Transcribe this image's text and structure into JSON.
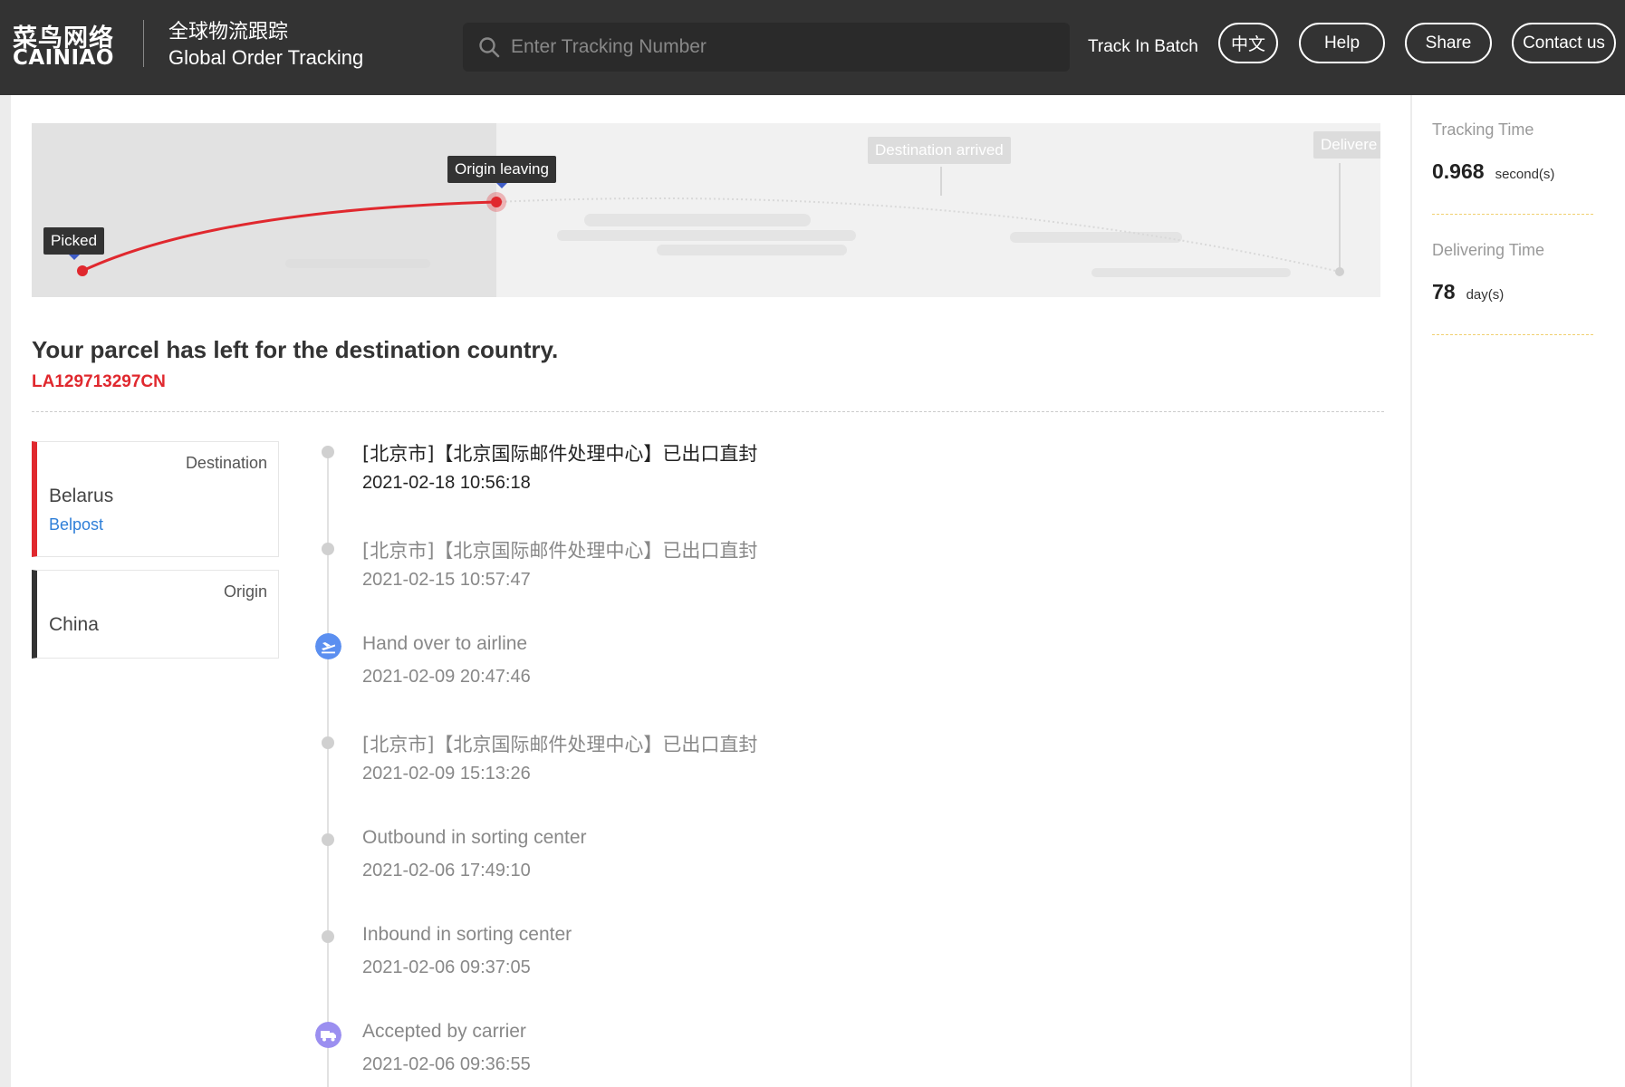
{
  "header": {
    "logo_cn": "菜鸟网络",
    "logo_en": "CAINIAO",
    "brand_cn": "全球物流跟踪",
    "brand_en": "Global Order Tracking",
    "search_placeholder": "Enter Tracking Number",
    "track_in_batch": "Track In Batch",
    "lang_label": "中文",
    "help_label": "Help",
    "share_label": "Share",
    "contact_label": "Contact us"
  },
  "progress": {
    "stages": [
      {
        "label": "Picked",
        "state": "done"
      },
      {
        "label": "Origin leaving",
        "state": "current"
      },
      {
        "label": "Destination arrived",
        "state": "pending"
      },
      {
        "label": "Delivere",
        "state": "pending"
      }
    ],
    "colors": {
      "done": "#e0282e",
      "pending": "#d6d6d6",
      "marker": "#3f5dc7"
    }
  },
  "parcel": {
    "status_title": "Your parcel has left for the destination country.",
    "tracking_number": "LA129713297CN"
  },
  "destination": {
    "label": "Destination",
    "country": "Belarus",
    "carrier": "Belpost"
  },
  "origin": {
    "label": "Origin",
    "country": "China"
  },
  "events": [
    {
      "title": "[北京市]【北京国际邮件处理中心】已出口直封",
      "time": "2021-02-18 10:56:18",
      "icon": "dot"
    },
    {
      "title": "[北京市]【北京国际邮件处理中心】已出口直封",
      "time": "2021-02-15 10:57:47",
      "icon": "dot"
    },
    {
      "title": "Hand over to airline",
      "time": "2021-02-09 20:47:46",
      "icon": "plane-icon"
    },
    {
      "title": "[北京市]【北京国际邮件处理中心】已出口直封",
      "time": "2021-02-09 15:13:26",
      "icon": "dot"
    },
    {
      "title": "Outbound in sorting center",
      "time": "2021-02-06 17:49:10",
      "icon": "dot"
    },
    {
      "title": "Inbound in sorting center",
      "time": "2021-02-06 09:37:05",
      "icon": "dot"
    },
    {
      "title": "Accepted by carrier",
      "time": "2021-02-06 09:36:55",
      "icon": "truck-icon"
    }
  ],
  "metrics": {
    "tracking_time": {
      "label": "Tracking Time",
      "value": "0.968",
      "unit": "second(s)"
    },
    "delivering_time": {
      "label": "Delivering Time",
      "value": "78",
      "unit": "day(s)"
    }
  },
  "colors": {
    "header_bg": "#333333",
    "accent_red": "#e0282e",
    "link_blue": "#2f7fd8",
    "plane_icon_bg": "#5b8ff0",
    "truck_icon_bg": "#9b8ff0"
  }
}
